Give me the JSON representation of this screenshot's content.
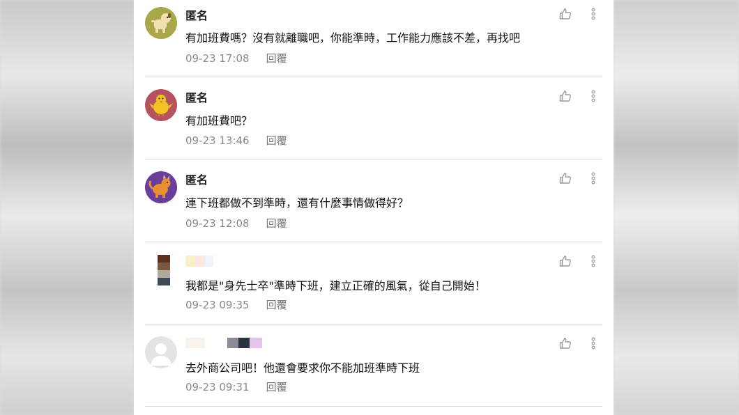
{
  "comments": [
    {
      "user": "匿名",
      "text": "有加班費嗎？沒有就離職吧，你能準時，工作能力應該不差，再找吧",
      "time": "09-23 17:08",
      "reply": "回覆",
      "avatar": "dog-avatar",
      "avatar_bg": "#a8a84a"
    },
    {
      "user": "匿名",
      "text": "有加班費吧？",
      "time": "09-23 13:46",
      "reply": "回覆",
      "avatar": "chick-avatar",
      "avatar_bg": "#b5545f"
    },
    {
      "user": "匿名",
      "text": "連下班都做不到準時，還有什麼事情做得好？",
      "time": "09-23 12:08",
      "reply": "回覆",
      "avatar": "dragon-avatar",
      "avatar_bg": "#6a3d9c"
    },
    {
      "user": "",
      "text": "我都是\"身先士卒\"準時下班，建立正確的風氣，從自己開始！",
      "time": "09-23 09:35",
      "reply": "回覆",
      "avatar": "blurred-photo-avatar"
    },
    {
      "user": "",
      "text": "去外商公司吧！他還會要求你不能加班準時下班",
      "time": "09-23 09:31",
      "reply": "回覆",
      "avatar": "default-user-avatar"
    }
  ],
  "icons": {
    "like": "thumbs-up-icon",
    "more": "more-vertical-icon"
  },
  "colors": {
    "text": "#111111",
    "meta": "#8a8a8a",
    "divider": "#d8d8d8"
  }
}
